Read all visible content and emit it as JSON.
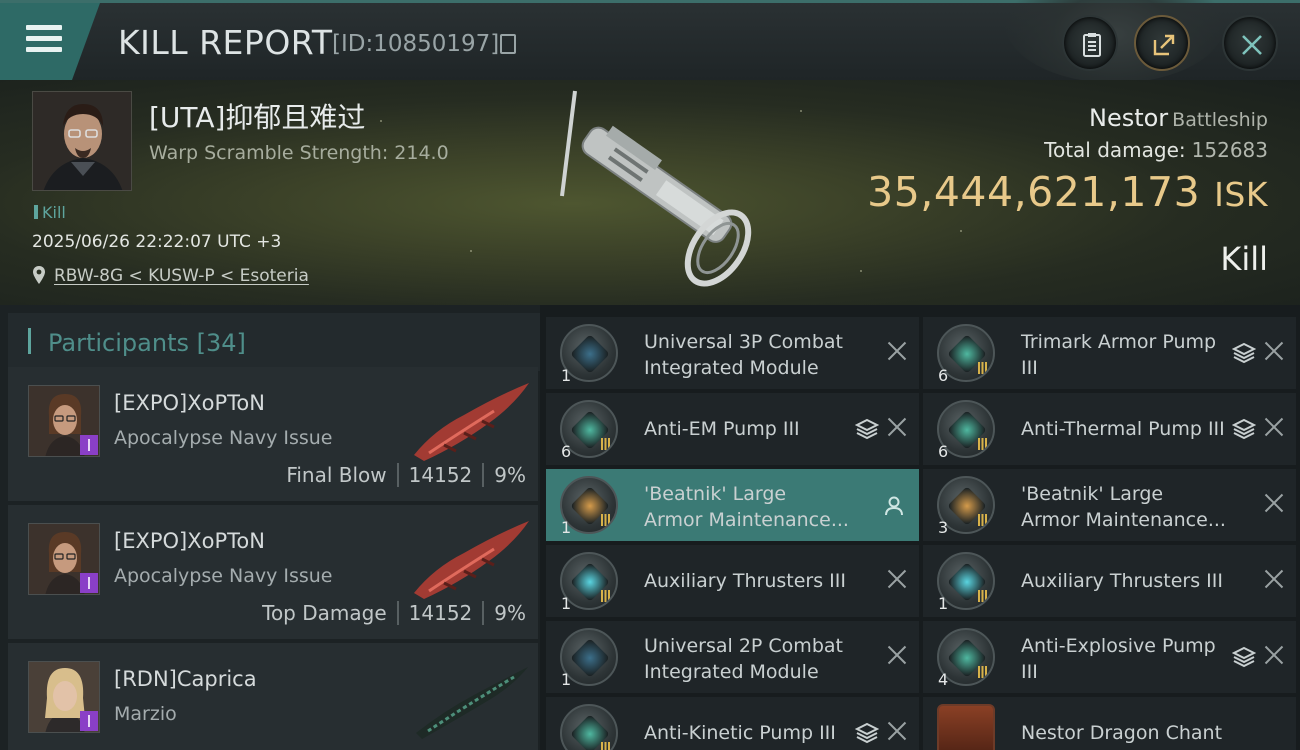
{
  "header": {
    "title": "KILL REPORT",
    "report_id": "[ID:10850197]",
    "menu_icon": "hamburger-menu-icon",
    "actions": [
      {
        "name": "clipboard",
        "icon": "clipboard-icon"
      },
      {
        "name": "share",
        "icon": "share-icon"
      },
      {
        "name": "close",
        "icon": "close-icon"
      }
    ]
  },
  "victim": {
    "name": "[UTA]抑郁且难过",
    "warp_scramble": "Warp Scramble Strength: 214.0",
    "kill_tag": "Kill",
    "datetime": "2025/06/26 22:22:07 UTC +3",
    "location": "RBW-8G < KUSW-P < Esoteria",
    "ship_name": "Nestor",
    "ship_class": "Battleship",
    "total_damage_label": "Total damage:",
    "total_damage": "152683",
    "isk_value": "35,444,621,173",
    "isk_unit": "ISK",
    "outcome": "Kill"
  },
  "participants": {
    "title": "Participants",
    "count": "[34]",
    "rows": [
      {
        "name": "[EXPO]XoPToN",
        "ship": "Apocalypse Navy Issue",
        "role": "Final Blow",
        "damage": "14152",
        "percent": "9%"
      },
      {
        "name": "[EXPO]XoPToN",
        "ship": "Apocalypse Navy Issue",
        "role": "Top Damage",
        "damage": "14152",
        "percent": "9%"
      },
      {
        "name": "[RDN]Caprica",
        "ship": "Marzio",
        "role": "",
        "damage": "",
        "percent": ""
      }
    ]
  },
  "modules": [
    {
      "name_1": "Universal 3P Combat",
      "name_2": "Integrated Module",
      "qty": "1",
      "stack": false,
      "selected": false,
      "close": true,
      "icon": "combat-module-icon",
      "accent": "#3c6f8a"
    },
    {
      "name_1": "Trimark Armor Pump",
      "name_2": "III",
      "qty": "6",
      "stack": true,
      "selected": false,
      "close": true,
      "icon": "armor-pump-icon",
      "accent": "#4fb8a0"
    },
    {
      "name_1": "Anti-EM Pump III",
      "name_2": "",
      "qty": "6",
      "stack": true,
      "selected": false,
      "close": true,
      "icon": "armor-pump-icon",
      "accent": "#4fb8a0"
    },
    {
      "name_1": "Anti-Thermal Pump III",
      "name_2": "",
      "qty": "6",
      "stack": true,
      "selected": false,
      "close": true,
      "icon": "armor-pump-icon",
      "accent": "#4fb8a0"
    },
    {
      "name_1": "'Beatnik' Large",
      "name_2": "Armor Maintenance...",
      "qty": "1",
      "stack": false,
      "selected": true,
      "close": false,
      "person": true,
      "icon": "armor-maintenance-icon",
      "accent": "#d59b4b"
    },
    {
      "name_1": "'Beatnik' Large",
      "name_2": "Armor Maintenance...",
      "qty": "3",
      "stack": false,
      "selected": false,
      "close": true,
      "icon": "armor-maintenance-icon",
      "accent": "#d59b4b"
    },
    {
      "name_1": "Auxiliary Thrusters III",
      "name_2": "",
      "qty": "1",
      "stack": false,
      "selected": false,
      "close": true,
      "icon": "thrusters-icon",
      "accent": "#5ad4e0"
    },
    {
      "name_1": "Auxiliary Thrusters III",
      "name_2": "",
      "qty": "1",
      "stack": false,
      "selected": false,
      "close": true,
      "icon": "thrusters-icon",
      "accent": "#5ad4e0"
    },
    {
      "name_1": "Universal 2P Combat",
      "name_2": "Integrated Module",
      "qty": "1",
      "stack": false,
      "selected": false,
      "close": true,
      "icon": "combat-module-icon",
      "accent": "#3c6f8a"
    },
    {
      "name_1": "Anti-Explosive Pump",
      "name_2": "III",
      "qty": "4",
      "stack": true,
      "selected": false,
      "close": true,
      "icon": "armor-pump-icon",
      "accent": "#4fb8a0"
    },
    {
      "name_1": "Anti-Kinetic Pump III",
      "name_2": "",
      "qty": "",
      "stack": true,
      "selected": false,
      "close": true,
      "icon": "armor-pump-icon",
      "accent": "#4fb8a0"
    },
    {
      "name_1": "Nestor Dragon Chant",
      "name_2": "",
      "qty": "",
      "stack": false,
      "selected": false,
      "close": false,
      "icon": "ship-skin-icon",
      "accent": "#a6462a",
      "square": true
    }
  ]
}
